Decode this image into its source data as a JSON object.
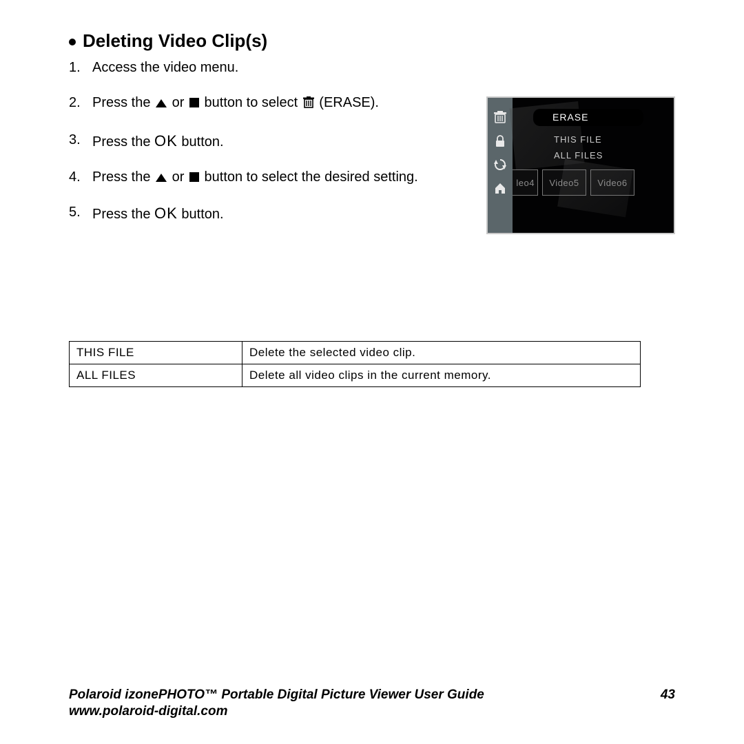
{
  "heading": "Deleting Video Clip(s)",
  "steps": {
    "s1": {
      "num": "1.",
      "text": "Access the video menu."
    },
    "s2": {
      "num": "2.",
      "prefix": "Press the ",
      "mid": " or ",
      "suffix": " button to select ",
      "tail": " (ERASE)."
    },
    "s3": {
      "num": "3.",
      "prefix": "Press the ",
      "ok": "OK",
      "suffix": " button."
    },
    "s4": {
      "num": "4.",
      "prefix": "Press the ",
      "mid": " or ",
      "suffix": " button to select the desired setting."
    },
    "s5": {
      "num": "5.",
      "prefix": "Press the ",
      "ok": "OK",
      "suffix": " button."
    }
  },
  "device": {
    "menu_title": "ERASE",
    "menu_items": [
      "THIS FILE",
      "ALL FILES"
    ],
    "thumbs": [
      "leo4",
      "Video5",
      "Video6"
    ]
  },
  "defs": [
    {
      "key": "THIS FILE",
      "val": "Delete the selected video clip."
    },
    {
      "key": "ALL FILES",
      "val": "Delete all video clips in the current memory."
    }
  ],
  "footer": {
    "title": "Polaroid izonePHOTO™ Portable Digital Picture Viewer User Guide",
    "page": "43",
    "url": "www.polaroid-digital.com"
  }
}
